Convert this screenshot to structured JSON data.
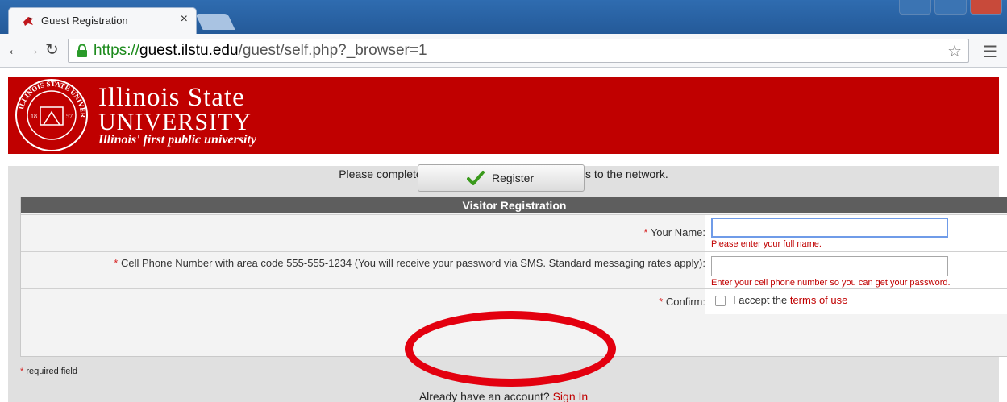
{
  "browser": {
    "tab_title": "Guest Registration",
    "tab_close": "×",
    "url_scheme": "https://",
    "url_host": "guest.ilstu.edu",
    "url_path": "/guest/self.php?_browser=1"
  },
  "header": {
    "line1": "Illinois State",
    "line2": "UNIVERSITY",
    "tagline": "Illinois' first public university",
    "brand_color": "#c00000",
    "seal_text": "ILLINOIS STATE UNIVERSITY",
    "seal_year_left": "18",
    "seal_year_right": "57"
  },
  "page": {
    "intro": "Please complete the form below to request access to the network."
  },
  "form": {
    "title": "Visitor Registration",
    "required_mark": "*",
    "name_label": "Your Name:",
    "name_value": "",
    "name_hint": "Please enter your full name.",
    "phone_label": "Cell Phone Number with area code 555-555-1234 (You will receive your password via SMS. Standard messaging rates apply):",
    "phone_value": "",
    "phone_hint": "Enter your cell phone number so you can get your password.",
    "confirm_label": "Confirm:",
    "accept_text": "I accept the",
    "terms_link": "terms of use",
    "register_label": "Register",
    "required_field_note": "required field"
  },
  "footer": {
    "account_prompt": "Already have an account?",
    "signin_link": "Sign In"
  },
  "icons": {
    "favicon": "cardinal-icon",
    "check": "checkmark-icon",
    "lock": "lock-icon"
  },
  "colors": {
    "accent_red": "#c00000",
    "annotation_ring": "#e3000f",
    "header_bar": "#5e5e5e",
    "check_green": "#3a9a1c"
  }
}
